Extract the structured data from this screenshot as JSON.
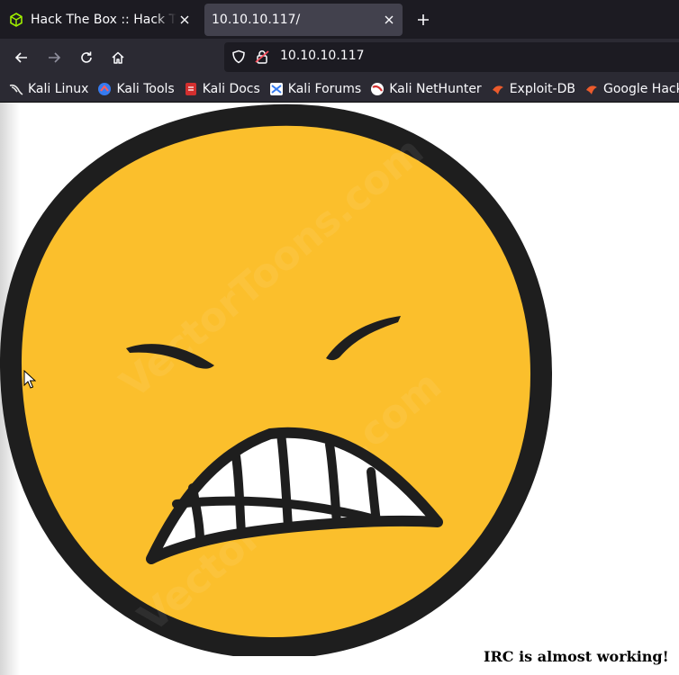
{
  "browser": {
    "tabs": [
      {
        "label": "Hack The Box :: Hack The Box",
        "active": false,
        "icon": "cube-icon"
      },
      {
        "label": "10.10.10.117/",
        "active": true
      }
    ],
    "url": "10.10.10.117",
    "bookmarks": [
      {
        "label": "Kali Linux",
        "icon": "kali-dragon-icon"
      },
      {
        "label": "Kali Tools",
        "icon": "kali-tools-icon"
      },
      {
        "label": "Kali Docs",
        "icon": "kali-docs-icon"
      },
      {
        "label": "Kali Forums",
        "icon": "kali-forums-icon"
      },
      {
        "label": "Kali NetHunter",
        "icon": "nethunter-icon"
      },
      {
        "label": "Exploit-DB",
        "icon": "exploit-db-icon"
      },
      {
        "label": "Google Hacking DB",
        "icon": "ghdb-icon"
      }
    ]
  },
  "page": {
    "image": "angry-grimacing-face-image",
    "message": "IRC is almost working!"
  },
  "colors": {
    "tabstrip": "#1c1b22",
    "toolbar": "#2b2a33",
    "face_fill": "#fbbf2c",
    "face_outline": "#1e1e1e"
  }
}
